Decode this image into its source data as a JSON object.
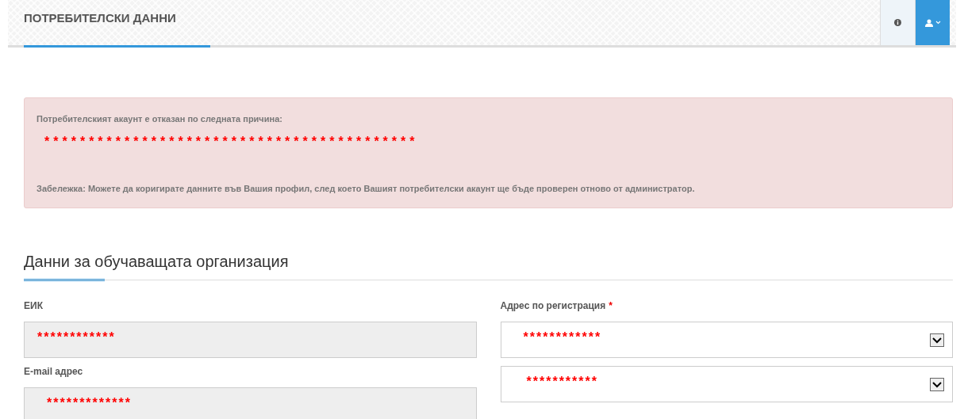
{
  "header": {
    "title": "ПОТРЕБИТЕЛСКИ ДАННИ"
  },
  "alert": {
    "reason_label": "Потребителският акаунт е отказан по следната причина:",
    "reason": "******************************************",
    "note": "Забележка: Можете да коригирате данните във Вашия профил, след което Вашият потребителски акаунт ще бъде проверен отново от администратор."
  },
  "section": {
    "title": "Данни за обучаващата организация"
  },
  "left_fields": [
    {
      "kind": "input",
      "label": "ЕИК",
      "value": "************",
      "disabled": true
    },
    {
      "kind": "input",
      "label": "E-mail адрес",
      "value": "*************",
      "disabled": true
    }
  ],
  "right_fields": [
    {
      "kind": "select",
      "label": "Адрес по регистрация",
      "required_mark": "*",
      "value": "************"
    },
    {
      "kind": "select",
      "value": "***********"
    }
  ]
}
